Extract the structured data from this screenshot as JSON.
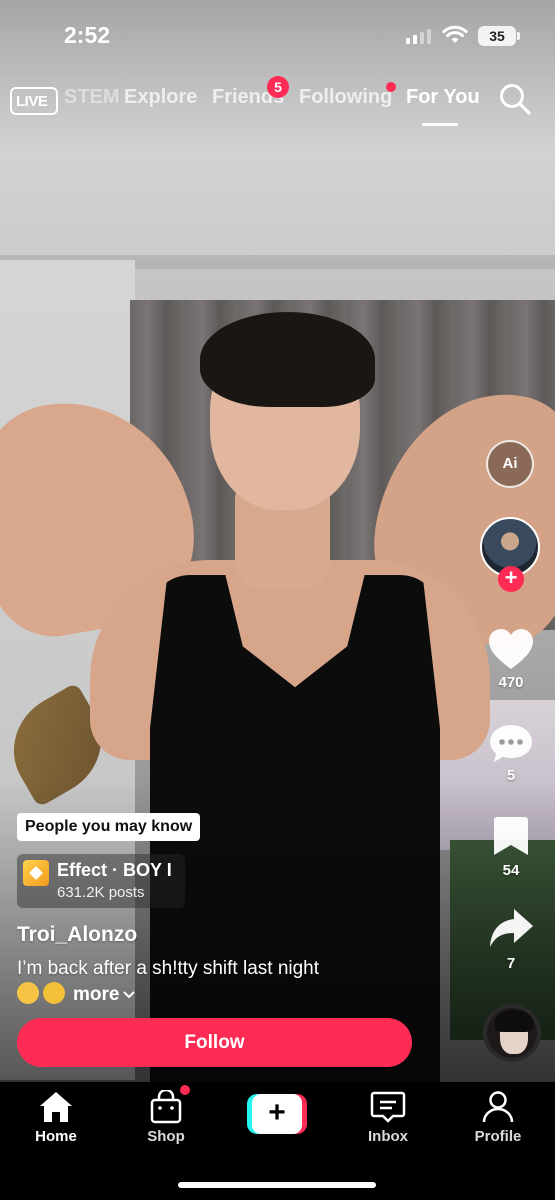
{
  "status_bar": {
    "time": "2:52",
    "battery": "35"
  },
  "top_nav": {
    "live_label": "LIVE",
    "tabs": [
      {
        "label": "STEM"
      },
      {
        "label": "Explore"
      },
      {
        "label": "Friends",
        "badge": "5"
      },
      {
        "label": "Following"
      },
      {
        "label": "For You",
        "active": true
      }
    ]
  },
  "right_rail": {
    "ai_label": "Ai",
    "likes": "470",
    "comments": "5",
    "saves": "54",
    "shares": "7"
  },
  "post": {
    "people_you_may_know": "People you may know",
    "effect_title": "Effect · BOY I",
    "effect_posts": "631.2K posts",
    "username": "Troi_Alonzo",
    "caption_line1": "I’m back after a sh!tty shift last night",
    "caption_more": "more",
    "follow_label": "Follow"
  },
  "bottom_nav": {
    "home": "Home",
    "shop": "Shop",
    "create": "+",
    "inbox": "Inbox",
    "profile": "Profile"
  },
  "colors": {
    "accent": "#fe2c55",
    "cyan": "#25f4ee"
  }
}
